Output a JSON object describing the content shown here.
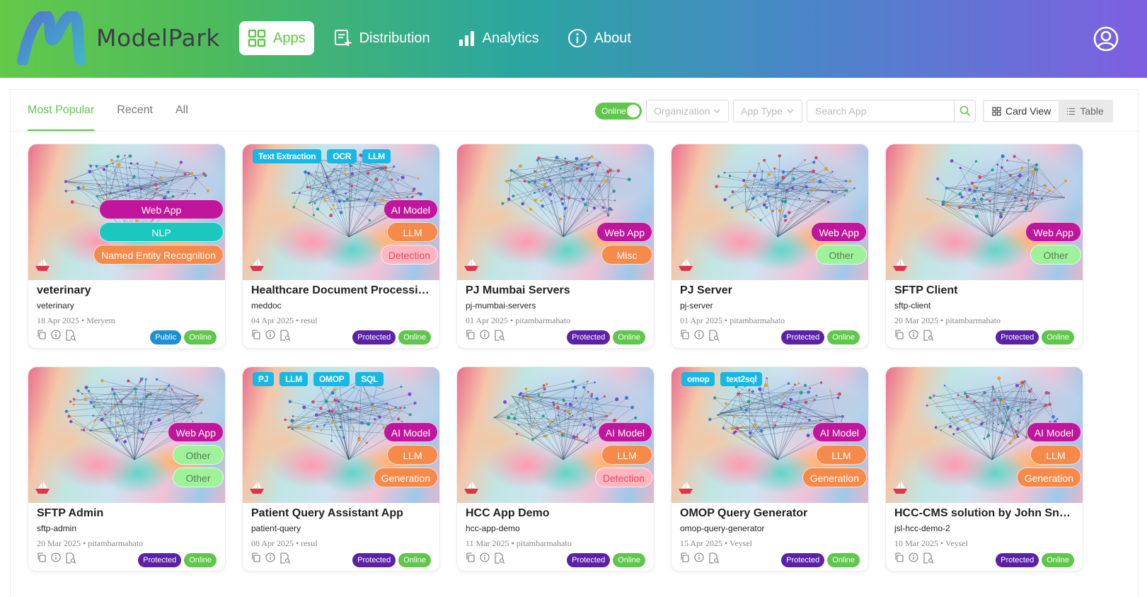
{
  "brand": {
    "name": "ModelPark"
  },
  "nav": [
    {
      "label": "Apps",
      "icon": "grid-icon",
      "active": true
    },
    {
      "label": "Distribution",
      "icon": "distribution-icon",
      "active": false
    },
    {
      "label": "Analytics",
      "icon": "bar-chart-icon",
      "active": false
    },
    {
      "label": "About",
      "icon": "info-icon",
      "active": false
    }
  ],
  "tabs": [
    {
      "label": "Most Popular",
      "active": true
    },
    {
      "label": "Recent",
      "active": false
    },
    {
      "label": "All",
      "active": false
    }
  ],
  "filters": {
    "online_toggle": "Online",
    "organization": "Organization",
    "app_type": "App Type",
    "search_placeholder": "Search App",
    "card_view": "Card View",
    "table_view": "Table"
  },
  "colors": {
    "accent": "#5fc74b",
    "protected": "#5b22a8",
    "public": "#1e8fd1",
    "top_tag": "#17b8e6"
  },
  "cards": [
    {
      "title": "veterinary",
      "slug": "veterinary",
      "meta": "18 Apr 2025 • Meryem",
      "top_tags": [],
      "pills": [
        "Web App",
        "NLP",
        "Named Entity Recognition"
      ],
      "access": "Public",
      "status": "Online"
    },
    {
      "title": "Healthcare Document Processing & Data Extraction",
      "slug": "meddoc",
      "meta": "04 Apr 2025 • resul",
      "top_tags": [
        "Text Extraction",
        "OCR",
        "LLM"
      ],
      "pills": [
        "AI Model",
        "LLM",
        "Detection"
      ],
      "access": "Protected",
      "status": "Online"
    },
    {
      "title": "PJ Mumbai Servers",
      "slug": "pj-mumbai-servers",
      "meta": "01 Apr 2025 • pitambarmahato",
      "top_tags": [],
      "pills": [
        "Web App",
        "Misc"
      ],
      "access": "Protected",
      "status": "Online"
    },
    {
      "title": "PJ Server",
      "slug": "pj-server",
      "meta": "01 Apr 2025 • pitambarmahato",
      "top_tags": [],
      "pills": [
        "Web App",
        "Other"
      ],
      "access": "Protected",
      "status": "Online"
    },
    {
      "title": "SFTP Client",
      "slug": "sftp-client",
      "meta": "20 Mar 2025 • pitambarmahato",
      "top_tags": [],
      "pills": [
        "Web App",
        "Other"
      ],
      "access": "Protected",
      "status": "Online"
    },
    {
      "title": "SFTP Admin",
      "slug": "sftp-admin",
      "meta": "20 Mar 2025 • pitambarmahato",
      "top_tags": [],
      "pills": [
        "Web App",
        "Other",
        "Other"
      ],
      "access": "Protected",
      "status": "Online"
    },
    {
      "title": "Patient Query Assistant App",
      "slug": "patient-query",
      "meta": "08 Apr 2025 • resul",
      "top_tags": [
        "PJ",
        "LLM",
        "OMOP",
        "SQL"
      ],
      "pills": [
        "AI Model",
        "LLM",
        "Generation"
      ],
      "access": "Protected",
      "status": "Online"
    },
    {
      "title": "HCC App Demo",
      "slug": "hcc-app-demo",
      "meta": "11 Mar 2025 • pitambarmahato",
      "top_tags": [],
      "pills": [
        "AI Model",
        "LLM",
        "Detection"
      ],
      "access": "Protected",
      "status": "Online"
    },
    {
      "title": "OMOP Query Generator",
      "slug": "omop-query-generator",
      "meta": "15 Apr 2025 • Veysel",
      "top_tags": [
        "omop",
        "text2sql"
      ],
      "pills": [
        "AI Model",
        "LLM",
        "Generation"
      ],
      "access": "Protected",
      "status": "Online"
    },
    {
      "title": "HCC-CMS solution by John Snow Labs",
      "slug": "jsl-hcc-demo-2",
      "meta": "10 Mar 2025 • Veysel",
      "top_tags": [],
      "pills": [
        "AI Model",
        "LLM",
        "Generation"
      ],
      "access": "Protected",
      "status": "Online"
    }
  ]
}
